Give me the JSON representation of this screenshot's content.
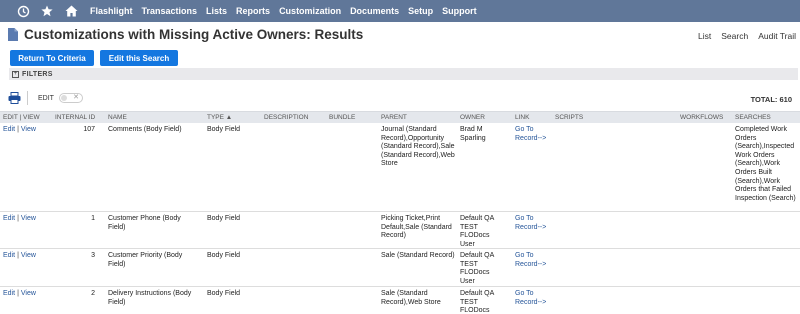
{
  "nav": {
    "icons": [
      "recent-records-icon",
      "star-icon",
      "home-icon"
    ],
    "items": [
      "Flashlight",
      "Transactions",
      "Lists",
      "Reports",
      "Customization",
      "Documents",
      "Setup",
      "Support"
    ],
    "bg_color": "#607799"
  },
  "header": {
    "title": "Customizations with Missing Active Owners: Results",
    "links": [
      "List",
      "Search",
      "Audit Trail"
    ]
  },
  "buttons": {
    "return": "Return To Criteria",
    "edit_search": "Edit this Search",
    "color": "#1477e0"
  },
  "filters": {
    "label": "FILTERS",
    "toggle": "+"
  },
  "toolbar": {
    "edit_label": "EDIT",
    "toggle_mark": "✕",
    "total": "TOTAL: 610"
  },
  "table": {
    "columns": {
      "editview": "EDIT | VIEW",
      "id": "INTERNAL ID",
      "name": "NAME",
      "type": "TYPE ▲",
      "desc": "DESCRIPTION",
      "bundle": "BUNDLE",
      "parent": "PARENT",
      "owner": "OWNER",
      "link": "LINK",
      "scripts": "SCRIPTS",
      "workflows": "WORKFLOWS",
      "searches": "SEARCHES"
    },
    "edit_label": "Edit",
    "view_label": "View",
    "sep": "|",
    "rows": [
      {
        "id": "107",
        "name": "Comments (Body Field)",
        "type": "Body Field",
        "desc": "",
        "bundle": "",
        "parent": "Journal (Standard Record),Opportunity (Standard Record),Sale (Standard Record),Web Store",
        "owner": "Brad M Sparling",
        "link": "Go To Record-->",
        "scripts": "",
        "workflows": "",
        "searches": "Completed Work Orders (Search),Inspected Work Orders (Search),Work Orders Built (Search),Work Orders that Failed Inspection (Search)"
      },
      {
        "id": "1",
        "name": "Customer Phone (Body Field)",
        "type": "Body Field",
        "desc": "",
        "bundle": "",
        "parent": "Picking Ticket,Print Default,Sale (Standard Record)",
        "owner": "Default QA TEST FLODocs User",
        "link": "Go To Record-->",
        "scripts": "",
        "workflows": "",
        "searches": ""
      },
      {
        "id": "3",
        "name": "Customer Priority (Body Field)",
        "type": "Body Field",
        "desc": "",
        "bundle": "",
        "parent": "Sale (Standard Record)",
        "owner": "Default QA TEST FLODocs User",
        "link": "Go To Record-->",
        "scripts": "",
        "workflows": "",
        "searches": ""
      },
      {
        "id": "2",
        "name": "Delivery Instructions (Body Field)",
        "type": "Body Field",
        "desc": "",
        "bundle": "",
        "parent": "Sale (Standard Record),Web Store",
        "owner": "Default QA TEST FLODocs User",
        "link": "Go To Record-->",
        "scripts": "",
        "workflows": "",
        "searches": ""
      }
    ]
  }
}
